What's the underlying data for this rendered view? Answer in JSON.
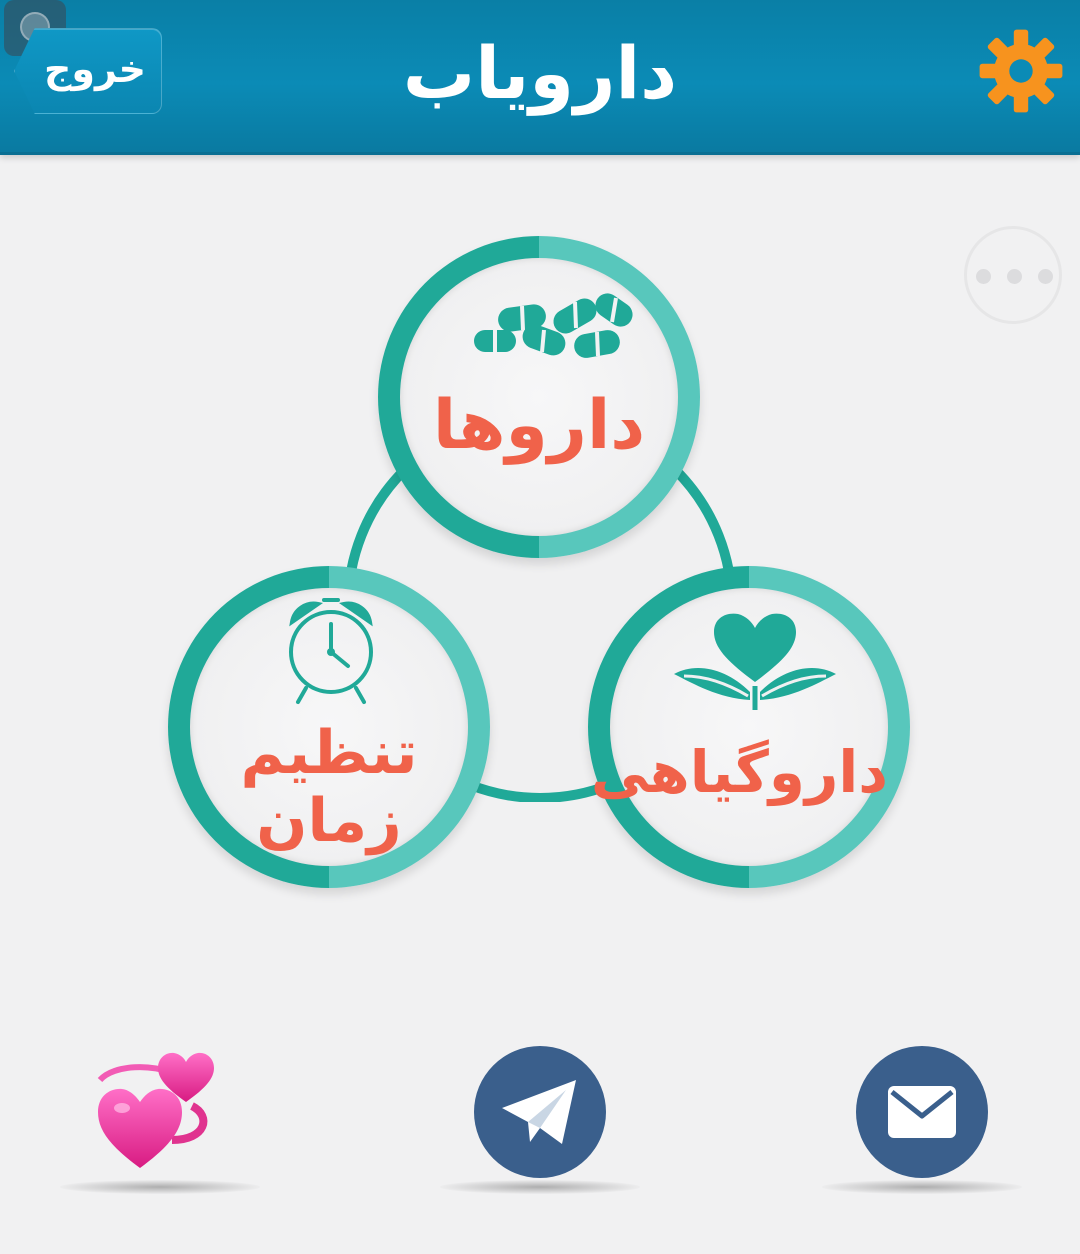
{
  "header": {
    "title": "دارویاب",
    "exit_label": "خروج"
  },
  "menu": {
    "drugs_label": "داروها",
    "herbal_label": "داروگیاهی",
    "reminder_label_line1": "تنظیم",
    "reminder_label_line2": "زمان"
  },
  "icons": {
    "settings": "gear-icon",
    "more": "more-dots-icon",
    "drugs": "pills-icon",
    "herbal": "leaf-heart-icon",
    "reminder": "alarm-clock-icon",
    "favorite": "hearts-icon",
    "telegram": "telegram-icon",
    "mail": "mail-icon"
  },
  "colors": {
    "header": "#0b8bb6",
    "accent": "#20a998",
    "accent_light": "#58c7bc",
    "label": "#f0624a",
    "gear": "#f7931e",
    "social": "#3a5f8c"
  }
}
